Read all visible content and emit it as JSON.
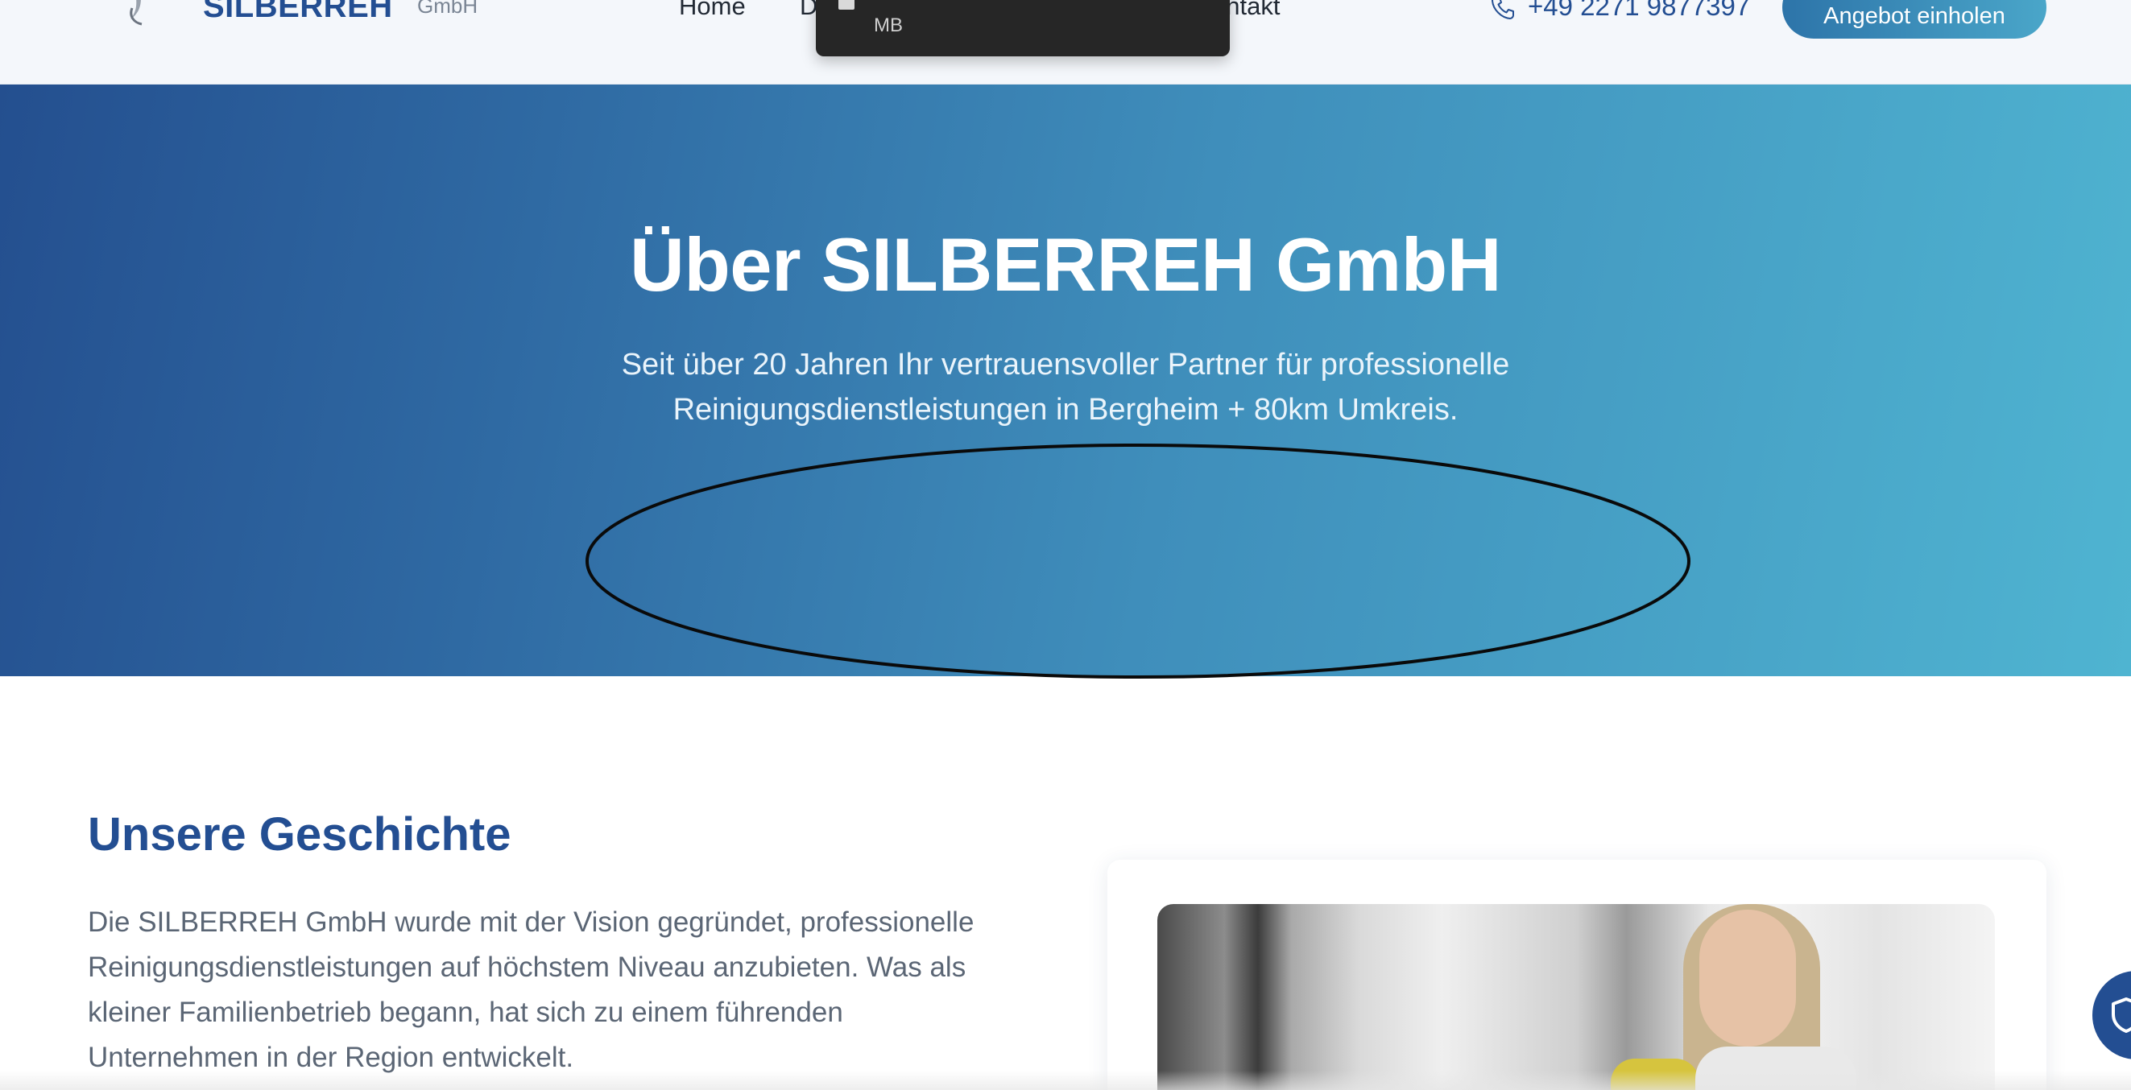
{
  "header": {
    "logo_name": "SILBERREH",
    "logo_suffix": "GmbH",
    "nav": [
      "Home",
      "D",
      "ontakt"
    ],
    "phone": "+49 2271 9877397",
    "cta_label": "Angebot einholen"
  },
  "toast": {
    "line1": "",
    "line2": "MB"
  },
  "hero": {
    "title": "Über SILBERREH GmbH",
    "subtitle_line1": "Seit über 20 Jahren Ihr vertrauensvoller Partner für professionelle",
    "subtitle_line2": "Reinigungsdienstleistungen in Bergheim + 80km Umkreis."
  },
  "story": {
    "title": "Unsere Geschichte",
    "body_lines": [
      "Die SILBERREH GmbH wurde mit der Vision gegründet, professionelle",
      "Reinigungsdienstleistungen auf höchstem Niveau anzubieten. Was als",
      "kleiner Familienbetrieb begann, hat sich zu einem führenden",
      "Unternehmen in der Region entwickelt."
    ]
  },
  "colors": {
    "brand_blue": "#234e92",
    "hero_gradient_start": "#244f8f",
    "hero_gradient_end": "#4fb4d1",
    "cta_start": "#2d74a9",
    "cta_end": "#4aa6c9"
  },
  "icons": {
    "logo": "logo-mark-icon",
    "phone": "phone-icon",
    "toast": "file-icon",
    "chat": "chat-icon"
  }
}
